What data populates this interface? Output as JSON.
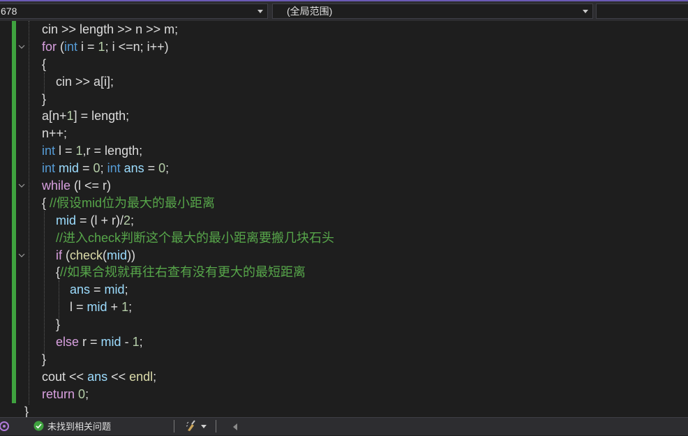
{
  "navbar": {
    "project_combo": "678",
    "scope_combo": "(全局范围)"
  },
  "code_lines": [
    {
      "tokens": [
        [
          "cin >> length >> n >> m;",
          "plain"
        ]
      ]
    },
    {
      "tokens": [
        [
          "for",
          "ctl"
        ],
        [
          " (",
          "plain"
        ],
        [
          "int",
          "kw"
        ],
        [
          " i = ",
          "plain"
        ],
        [
          "1",
          "num"
        ],
        [
          "; i <=n; i++)",
          "plain"
        ]
      ]
    },
    {
      "tokens": [
        [
          "{",
          "plain"
        ]
      ]
    },
    {
      "tokens": [
        [
          "    cin >> a[i];",
          "plain"
        ]
      ]
    },
    {
      "tokens": [
        [
          "}",
          "plain"
        ]
      ]
    },
    {
      "tokens": [
        [
          "a[n+",
          "plain"
        ],
        [
          "1",
          "num"
        ],
        [
          "] = length;",
          "plain"
        ]
      ]
    },
    {
      "tokens": [
        [
          "n++;",
          "plain"
        ]
      ]
    },
    {
      "tokens": [
        [
          "int",
          "kw"
        ],
        [
          " l = ",
          "plain"
        ],
        [
          "1",
          "num"
        ],
        [
          ",r = length;",
          "plain"
        ]
      ]
    },
    {
      "tokens": [
        [
          "int",
          "kw"
        ],
        [
          " mid",
          "var"
        ],
        [
          " = ",
          "plain"
        ],
        [
          "0",
          "num"
        ],
        [
          "; ",
          "plain"
        ],
        [
          "int",
          "kw"
        ],
        [
          " ans",
          "var"
        ],
        [
          " = ",
          "plain"
        ],
        [
          "0",
          "num"
        ],
        [
          ";",
          "plain"
        ]
      ]
    },
    {
      "tokens": [
        [
          "while",
          "ctl"
        ],
        [
          " (l <= r)",
          "plain"
        ]
      ]
    },
    {
      "tokens": [
        [
          "{ ",
          "plain"
        ],
        [
          "//假设mid位为最大的最小距离",
          "cmt"
        ]
      ]
    },
    {
      "tokens": [
        [
          "    mid",
          "var"
        ],
        [
          " = (l + r)/",
          "plain"
        ],
        [
          "2",
          "num"
        ],
        [
          ";",
          "plain"
        ]
      ]
    },
    {
      "tokens": [
        [
          "    //进入check判断这个最大的最小距离要搬几块石头",
          "cmt"
        ]
      ]
    },
    {
      "tokens": [
        [
          "    if",
          "ctl"
        ],
        [
          " (",
          "plain"
        ],
        [
          "check",
          "fn"
        ],
        [
          "(",
          "plain"
        ],
        [
          "mid",
          "var"
        ],
        [
          "))",
          "plain"
        ]
      ]
    },
    {
      "tokens": [
        [
          "    {",
          "plain"
        ],
        [
          "//如果合规就再往右查有没有更大的最短距离",
          "cmt"
        ]
      ]
    },
    {
      "tokens": [
        [
          "        ans",
          "var"
        ],
        [
          " = ",
          "plain"
        ],
        [
          "mid",
          "var"
        ],
        [
          ";",
          "plain"
        ]
      ]
    },
    {
      "tokens": [
        [
          "        l = ",
          "plain"
        ],
        [
          "mid",
          "var"
        ],
        [
          " + ",
          "plain"
        ],
        [
          "1",
          "num"
        ],
        [
          ";",
          "plain"
        ]
      ]
    },
    {
      "tokens": [
        [
          "    }",
          "plain"
        ]
      ]
    },
    {
      "tokens": [
        [
          "    else",
          "ctl"
        ],
        [
          " r = ",
          "plain"
        ],
        [
          "mid",
          "var"
        ],
        [
          " - ",
          "plain"
        ],
        [
          "1",
          "num"
        ],
        [
          ";",
          "plain"
        ]
      ]
    },
    {
      "tokens": [
        [
          "}",
          "plain"
        ]
      ]
    },
    {
      "tokens": [
        [
          "cout << ",
          "plain"
        ],
        [
          "ans",
          "var"
        ],
        [
          " << ",
          "plain"
        ],
        [
          "endl",
          "fn"
        ],
        [
          ";",
          "plain"
        ]
      ]
    },
    {
      "tokens": [
        [
          "return",
          "ctl"
        ],
        [
          " ",
          "plain"
        ],
        [
          "0",
          "num"
        ],
        [
          ";",
          "plain"
        ]
      ]
    }
  ],
  "closing_brace": "}",
  "statusbar": {
    "issues_text": "未找到相关问题",
    "copilot_icon": "copilot-icon",
    "check_icon": "check-circle-icon",
    "brush_icon": "code-cleanup-icon"
  },
  "colors": {
    "keyword": "#569cd6",
    "control": "#d8a0df",
    "number": "#b5cea8",
    "variable": "#9cdcfe",
    "function": "#dcdcaa",
    "comment": "#57a64a",
    "change_marker": "#3fa23f"
  }
}
